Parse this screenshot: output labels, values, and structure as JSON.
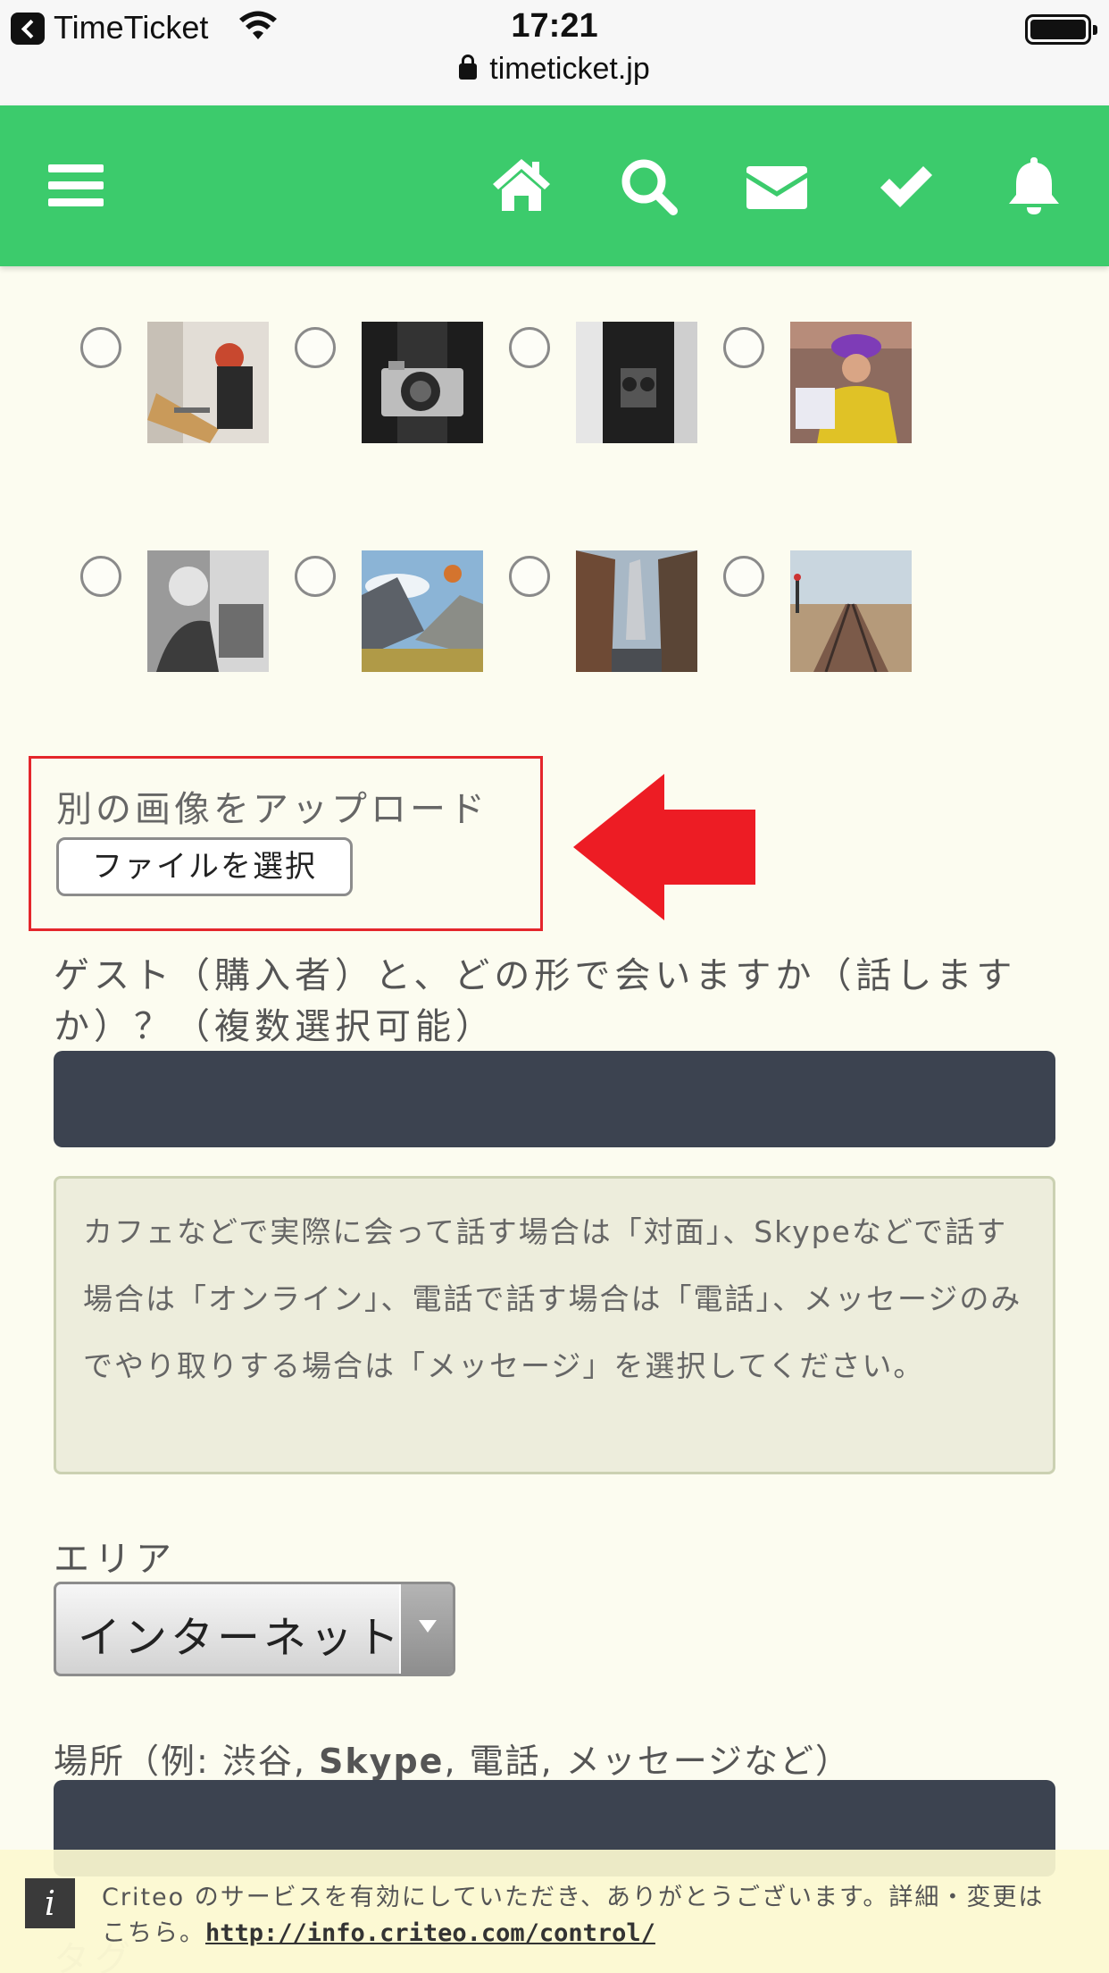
{
  "status_bar": {
    "back_app": "TimeTicket",
    "time": "17:21",
    "url": "timeticket.jp"
  },
  "nav": {
    "icons": [
      "menu-icon",
      "home-icon",
      "search-icon",
      "mail-icon",
      "check-icon",
      "bell-icon"
    ],
    "color": "#3ccb6c"
  },
  "image_choices": [
    {
      "id": "img1",
      "subject": "person drawing at desk"
    },
    {
      "id": "img2",
      "subject": "vintage camera"
    },
    {
      "id": "img3",
      "subject": "person holding camera"
    },
    {
      "id": "img4",
      "subject": "person with purple hat and laptop"
    },
    {
      "id": "img5",
      "subject": "man working in workshop"
    },
    {
      "id": "img6",
      "subject": "hot air balloon over valley"
    },
    {
      "id": "img7",
      "subject": "city street with buildings"
    },
    {
      "id": "img8",
      "subject": "railway tracks by the coast"
    }
  ],
  "upload": {
    "label": "別の画像をアップロード",
    "button": "ファイルを選択"
  },
  "question": {
    "text": "ゲスト（購入者）と、どの形で会いますか（話しますか）？（複数選択可能）"
  },
  "note": {
    "text": "カフェなどで実際に会って話す場合は「対面」、Skypeなどで話す場合は「オンライン」、電話で話す場合は「電話」、メッセージのみでやり取りする場合は「メッセージ」を選択してください。"
  },
  "area": {
    "label": "エリア",
    "selected": "インターネット"
  },
  "place": {
    "prefix": "場所（例: 渋谷, ",
    "bold1": "Skype",
    "mid1": ", 電話",
    "mid2": ", メッセージなど）"
  },
  "tag": {
    "label": "タグ"
  },
  "criteo": {
    "icon": "i",
    "text": "Criteo のサービスを有効にしていただき、ありがとうございます。詳細・変更はこちら。",
    "link": "http://info.criteo.com/control/"
  }
}
